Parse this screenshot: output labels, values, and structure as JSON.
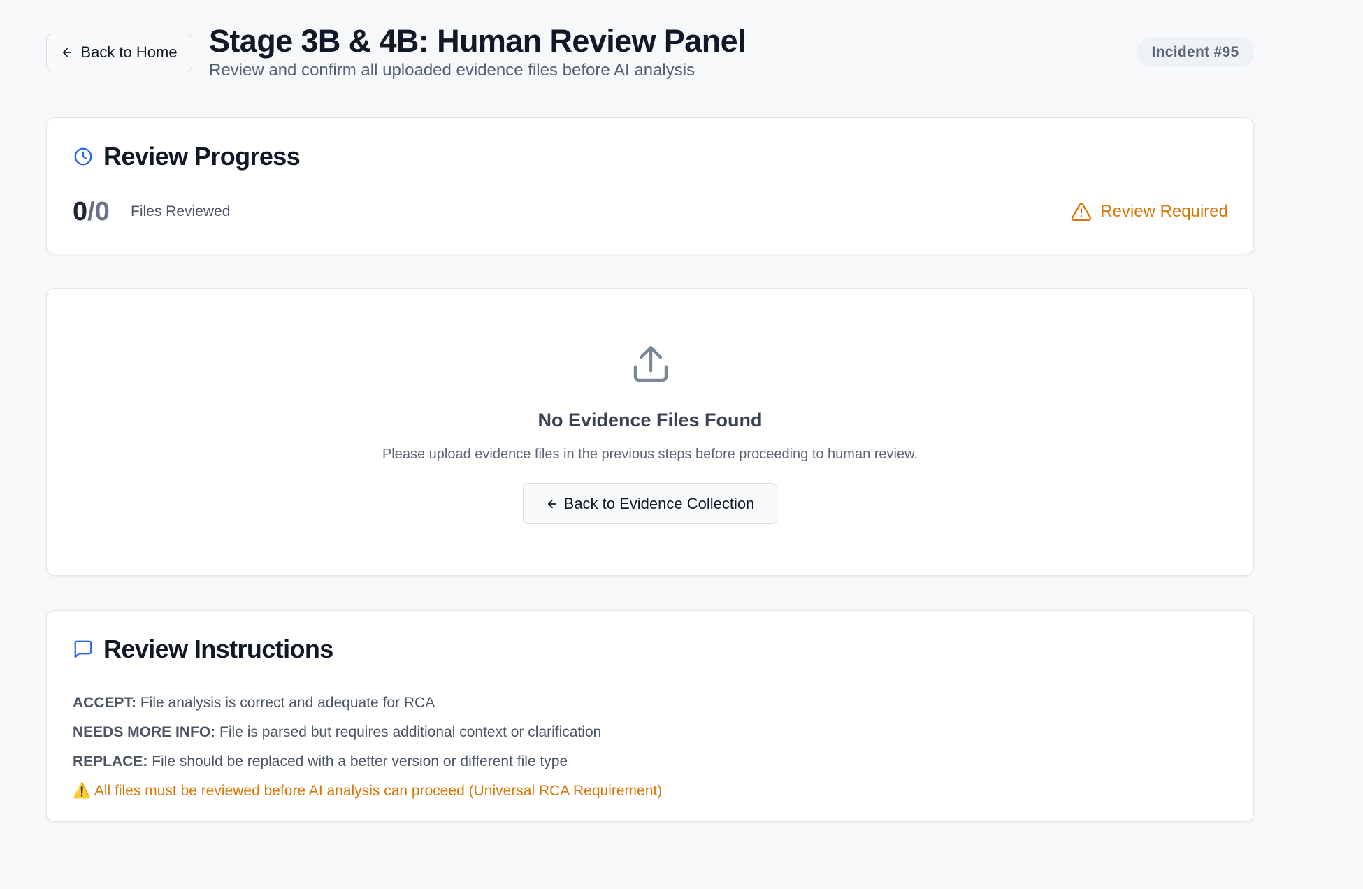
{
  "header": {
    "back_home_label": "Back to Home",
    "title": "Stage 3B & 4B: Human Review Panel",
    "subtitle": "Review and confirm all uploaded evidence files before AI analysis",
    "incident_label": "Incident #95"
  },
  "progress": {
    "title": "Review Progress",
    "reviewed": "0",
    "separator": "/",
    "total": "0",
    "label": "Files Reviewed",
    "status": "Review Required"
  },
  "empty_state": {
    "title": "No Evidence Files Found",
    "message": "Please upload evidence files in the previous steps before proceeding to human review.",
    "back_button_label": "Back to Evidence Collection"
  },
  "instructions": {
    "title": "Review Instructions",
    "items": [
      {
        "label": "ACCEPT:",
        "text": "File analysis is correct and adequate for RCA"
      },
      {
        "label": "NEEDS MORE INFO:",
        "text": "File is parsed but requires additional context or clarification"
      },
      {
        "label": "REPLACE:",
        "text": "File should be replaced with a better version or different file type"
      }
    ],
    "warning": "All files must be reviewed before AI analysis can proceed (Universal RCA Requirement)"
  },
  "colors": {
    "background": "#f7f8fa",
    "card": "#ffffff",
    "accent_blue": "#2563eb",
    "warning_orange": "#d97706",
    "muted_text": "#4a5568"
  },
  "icons": {
    "back": "arrow-left-icon",
    "progress": "clock-icon",
    "status": "warning-triangle-icon",
    "empty_state": "upload-icon",
    "instructions": "message-square-icon",
    "warning": "warning-emoji-icon"
  }
}
